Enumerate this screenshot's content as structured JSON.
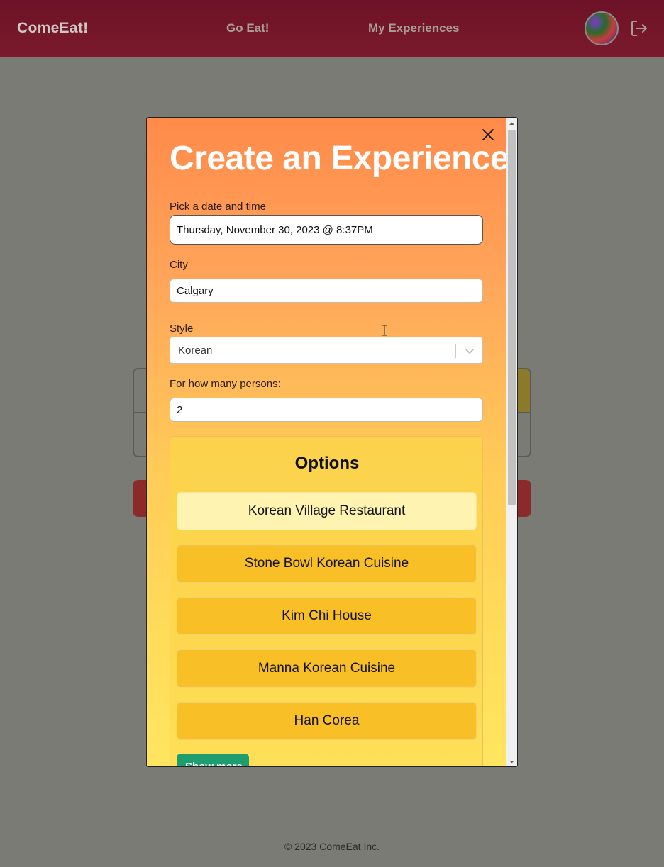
{
  "navbar": {
    "brand": "ComeEat!",
    "links": [
      "Go Eat!",
      "My Experiences"
    ],
    "avatar_icon": "user-avatar",
    "logout_icon": "logout-icon"
  },
  "modal": {
    "title": "Create an Experience",
    "close_icon": "close-icon",
    "date_label": "Pick a date and time",
    "date_value": "Thursday, November 30, 2023 @ 8:37PM",
    "city_label": "City",
    "city_value": "Calgary",
    "style_label": "Style",
    "style_value": "Korean",
    "persons_label": "For how many persons:",
    "persons_value": "2",
    "options": {
      "title": "Options",
      "items": [
        {
          "label": "Korean Village Restaurant",
          "selected": true
        },
        {
          "label": "Stone Bowl Korean Cuisine",
          "selected": false
        },
        {
          "label": "Kim Chi House",
          "selected": false
        },
        {
          "label": "Manna Korean Cuisine",
          "selected": false
        },
        {
          "label": "Han Corea",
          "selected": false
        }
      ],
      "show_more": "Show more"
    }
  },
  "footer": {
    "copyright": "© 2023 ComeEat Inc."
  },
  "colors": {
    "navbar": "#6e1227",
    "overlay": "#7b7b75",
    "option_button": "#f8bf26",
    "option_selected": "#fef3b0",
    "show_more": "#1e9e6e"
  }
}
